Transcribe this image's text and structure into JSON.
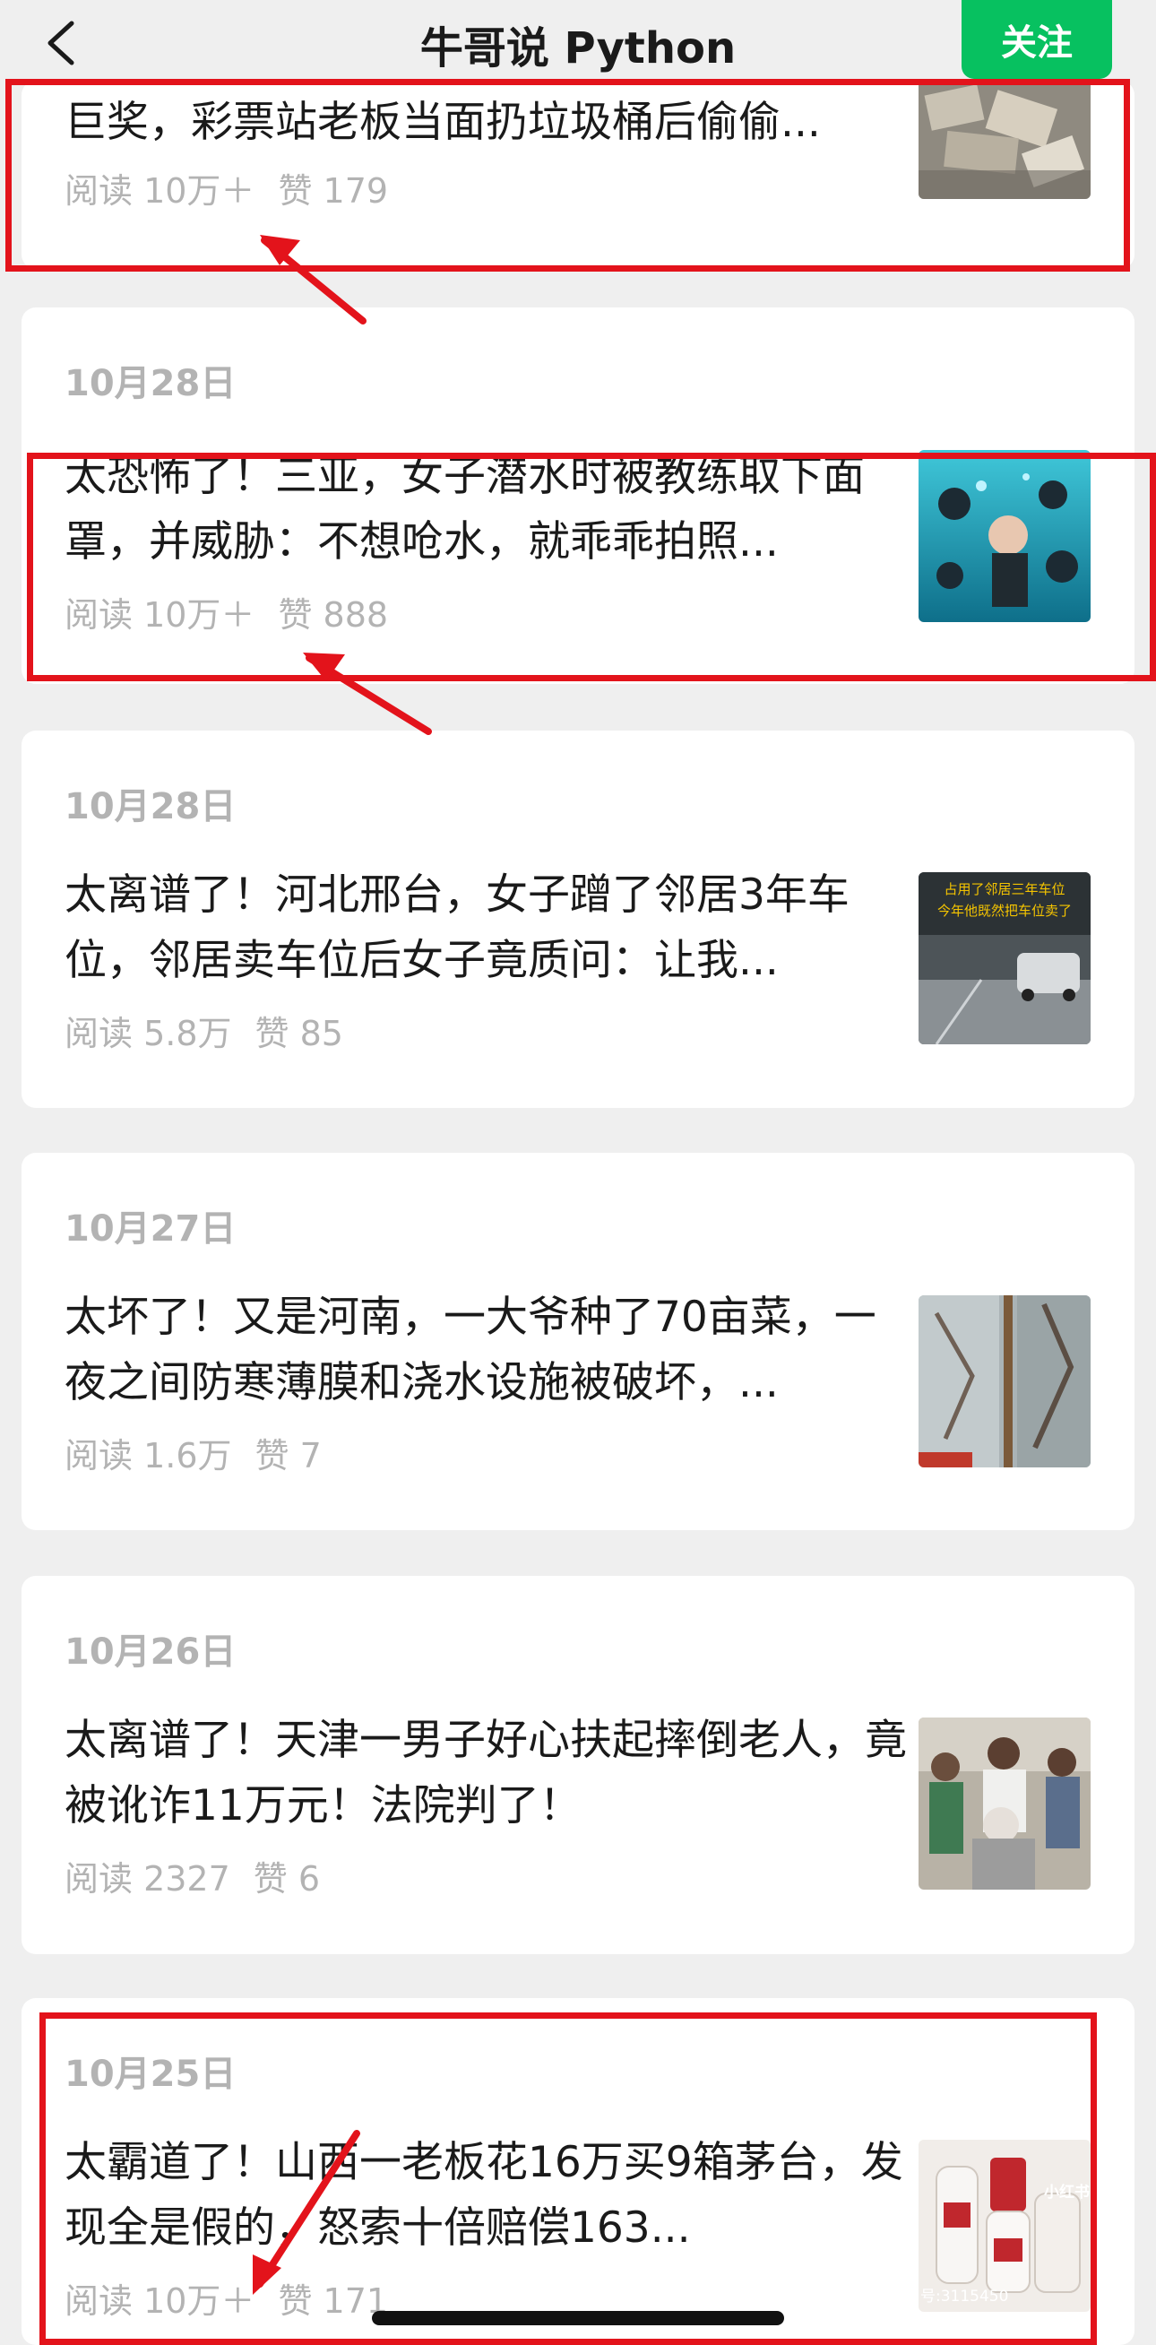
{
  "header": {
    "title": "牛哥说 Python",
    "follow_label": "关注"
  },
  "articles": [
    {
      "date": "",
      "title": "巨奖，彩票站老板当面扔垃圾桶后偷偷...",
      "reads": "阅读 10万＋",
      "likes": "赞 179"
    },
    {
      "date": "10月28日",
      "title": "太恐怖了！三亚，女子潜水时被教练取下面罩，并威胁：不想呛水，就乖乖拍照...",
      "reads": "阅读 10万＋",
      "likes": "赞 888"
    },
    {
      "date": "10月28日",
      "title": "太离谱了！河北邢台，女子蹭了邻居3年车位，邻居卖车位后女子竟质问：让我...",
      "reads": "阅读 5.8万",
      "likes": "赞 85",
      "thumb_caption_1": "占用了邻居三年车位",
      "thumb_caption_2": "今年他既然把车位卖了"
    },
    {
      "date": "10月27日",
      "title": "太坏了！又是河南，一大爷种了70亩菜，一夜之间防寒薄膜和浇水设施被破坏，...",
      "reads": "阅读 1.6万",
      "likes": "赞 7"
    },
    {
      "date": "10月26日",
      "title": "太离谱了！天津一男子好心扶起摔倒老人，竟被讹诈11万元！法院判了！",
      "reads": "阅读 2327",
      "likes": "赞 6"
    },
    {
      "date": "10月25日",
      "title": "太霸道了！山西一老板花16万买9箱茅台，发现全是假的，怒索十倍赔偿163...",
      "reads": "阅读 10万＋",
      "likes": "赞 171",
      "thumb_watermark": "小红书",
      "thumb_id": "号:3115450"
    }
  ],
  "colors": {
    "accent": "#07c160",
    "annotation": "#e3131b",
    "background": "#efefef"
  },
  "icons": {
    "back": "chevron-left-icon"
  }
}
